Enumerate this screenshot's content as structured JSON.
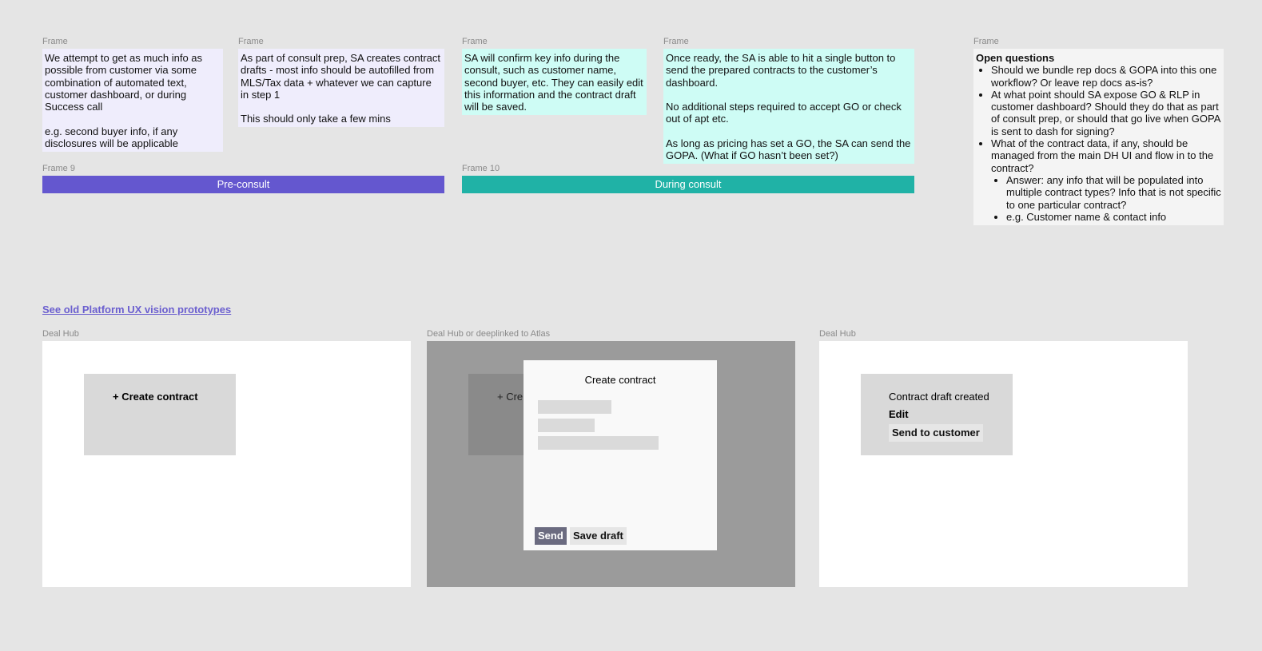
{
  "frame_labels": {
    "f1": "Frame",
    "f2": "Frame",
    "f3": "Frame",
    "f4": "Frame",
    "f5": "Frame",
    "f9": "Frame 9",
    "f10": "Frame 10"
  },
  "notes": {
    "n1": "We attempt to get as much info as possible from customer via some combination of automated text, customer dashboard, or during Success call\n\ne.g. second buyer info, if any disclosures will be applicable",
    "n2": "As part of consult prep, SA creates contract drafts - most info should be autofilled from MLS/Tax data + whatever we can capture in step 1\n\nThis should only take a few mins",
    "n3": "SA will confirm key info during the consult, such as customer name, second buyer, etc. They can easily edit this information and the contract draft will be saved.",
    "n4": "Once ready, the SA is able to hit a single button to send the prepared contracts to the customer’s dashboard.\n\nNo additional steps required to accept GO or check out of apt etc.\n\nAs long as pricing has set a GO, the SA can send the GOPA. (What if GO hasn’t been set?)"
  },
  "phases": {
    "pre": "Pre-consult",
    "during": "During consult"
  },
  "colors": {
    "pre_consult": "#6457cf",
    "during_consult": "#20b2a6",
    "link": "#6b5fcf"
  },
  "open_questions": {
    "title": "Open questions",
    "items": [
      "Should we bundle rep docs & GOPA into this one workflow? Or leave rep docs as-is?",
      "At what point should SA expose GO & RLP in customer dashboard? Should they do that as part of consult prep, or should that go live when GOPA is sent to dash for signing?",
      "What of the contract data, if any, should be managed from the main DH UI and flow in to the contract?"
    ],
    "sub_items": [
      "Answer: any info that will be populated into multiple contract types? Info that is not specific to one particular contract?",
      "e.g. Customer name & contact info"
    ]
  },
  "link": {
    "text": "See old Platform UX vision prototypes"
  },
  "screens": {
    "s1_label": "Deal Hub",
    "s2_label": "Deal Hub or deeplinked to Atlas",
    "s3_label": "Deal Hub",
    "create_contract": "+ Create contract",
    "create_contract_truncated": "+ Cre",
    "modal_title": "Create contract",
    "send": "Send",
    "save_draft": "Save draft",
    "draft_created": "Contract draft created",
    "edit": "Edit",
    "send_to_customer": "Send to customer"
  }
}
